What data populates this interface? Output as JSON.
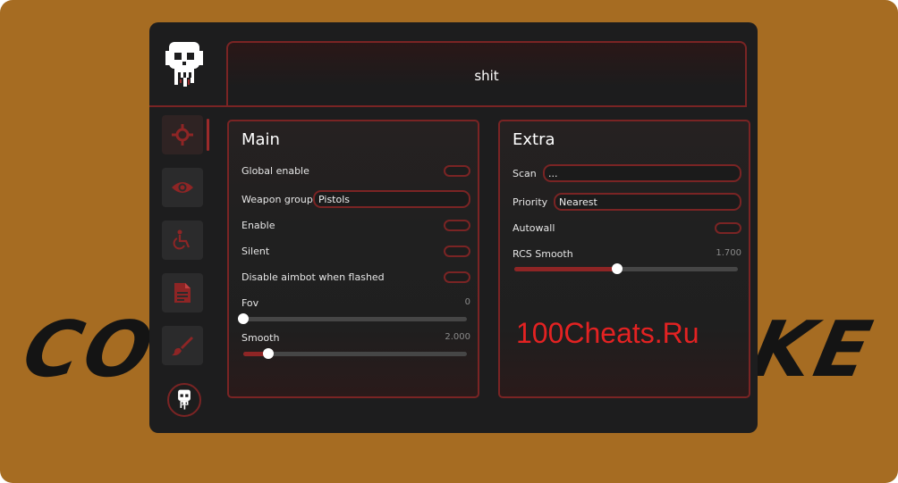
{
  "background": {
    "word_left": "CO",
    "word_right": "KE",
    "color": "#a66c22"
  },
  "header": {
    "title": "shit"
  },
  "watermark": "100Cheats.Ru",
  "sidebar": {
    "items": [
      {
        "icon": "crosshair-icon",
        "active": true
      },
      {
        "icon": "eye-icon",
        "active": false
      },
      {
        "icon": "wheelchair-icon",
        "active": false
      },
      {
        "icon": "document-icon",
        "active": false
      },
      {
        "icon": "brush-icon",
        "active": false
      }
    ]
  },
  "main": {
    "title": "Main",
    "global_enable": "Global enable",
    "weapon_group_label": "Weapon group",
    "weapon_group_value": "Pistols",
    "enable": "Enable",
    "silent": "Silent",
    "disable_flashed": "Disable aimbot when flashed",
    "fov_label": "Fov",
    "fov_value": "0",
    "fov_fraction": 0.0,
    "smooth_label": "Smooth",
    "smooth_value": "2.000",
    "smooth_fraction": 0.11
  },
  "extra": {
    "title": "Extra",
    "scan_label": "Scan",
    "scan_value": "...",
    "priority_label": "Priority",
    "priority_value": "Nearest",
    "autowall": "Autowall",
    "rcs_label": "RCS Smooth",
    "rcs_value": "1.700",
    "rcs_fraction": 0.46
  },
  "colors": {
    "accent": "#7a2424",
    "accent_fill": "#8e2525",
    "panel": "#1d1d1e"
  }
}
